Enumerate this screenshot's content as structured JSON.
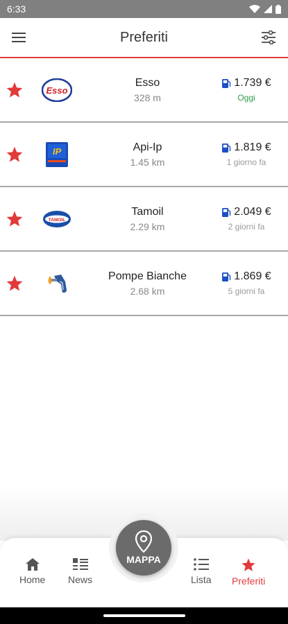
{
  "status_bar": {
    "time": "6:33"
  },
  "header": {
    "title": "Preferiti"
  },
  "stations": [
    {
      "name": "Esso",
      "distance": "328 m",
      "price": "1.739 €",
      "updated": "Oggi",
      "brand": "esso-logo",
      "today": true
    },
    {
      "name": "Api-Ip",
      "distance": "1.45 km",
      "price": "1.819 €",
      "updated": "1 giorno fa",
      "brand": "ip-logo",
      "today": false
    },
    {
      "name": "Tamoil",
      "distance": "2.29 km",
      "price": "2.049 €",
      "updated": "2 giorni fa",
      "brand": "tamoil-logo",
      "today": false
    },
    {
      "name": "Pompe Bianche",
      "distance": "2.68 km",
      "price": "1.869 €",
      "updated": "5 giorni fa",
      "brand": "fuel-nozzle-logo",
      "today": false
    }
  ],
  "bottom_nav": {
    "home": "Home",
    "news": "News",
    "map": "MAPPA",
    "list": "Lista",
    "favorites": "Preferiti"
  },
  "colors": {
    "accent": "#e23a3a",
    "today": "#2e9b4a",
    "pump": "#1d4fc4",
    "map_button": "#6b6b6b"
  }
}
